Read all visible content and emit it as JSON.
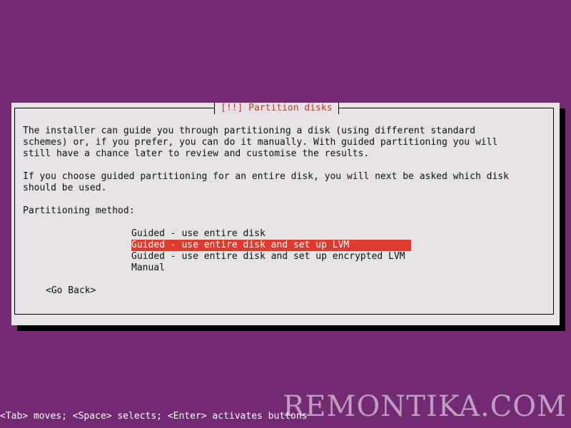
{
  "dialog": {
    "title": "[!!] Partition disks",
    "paragraph1": "The installer can guide you through partitioning a disk (using different standard\nschemes) or, if you prefer, you can do it manually. With guided partitioning you will\nstill have a chance later to review and customise the results.",
    "paragraph2": "If you choose guided partitioning for an entire disk, you will next be asked which disk\nshould be used.",
    "method_label": "Partitioning method:",
    "options": [
      "Guided - use entire disk",
      "Guided - use entire disk and set up LVM",
      "Guided - use entire disk and set up encrypted LVM",
      "Manual"
    ],
    "selected_index": 1,
    "back_button": "<Go Back>"
  },
  "status_bar": {
    "text": "<Tab> moves; <Space> selects; <Enter> activates buttons"
  },
  "watermark": {
    "text": "REMONTIKA.COM"
  },
  "colors": {
    "background": "#722a72",
    "dialog": "#e6e2e6",
    "title_text": "#c0392b",
    "selection": "#dd3b2d"
  }
}
